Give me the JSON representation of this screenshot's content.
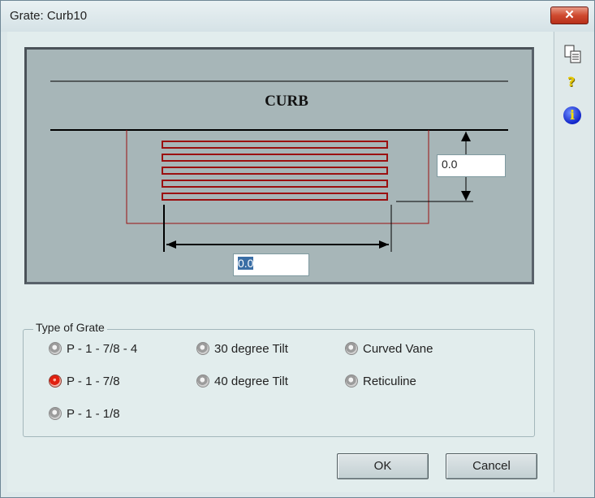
{
  "window": {
    "title": "Grate: Curb10",
    "close_label": "✕"
  },
  "sidebar": {
    "icons": [
      "copy-icon",
      "help-icon",
      "info-icon"
    ],
    "help_glyph": "?",
    "info_glyph": "i"
  },
  "diagram": {
    "curb_label": "CURB",
    "height_value": "0.0",
    "width_value": "0.0",
    "colors": {
      "grate_bars": "#9b1010",
      "inlet_outline": "#9b1010",
      "line": "#000000"
    }
  },
  "grate_type": {
    "title": "Type of Grate",
    "options": [
      {
        "label": "P - 1 - 7/8 - 4",
        "selected": false
      },
      {
        "label": "P - 1  - 7/8",
        "selected": true
      },
      {
        "label": "P - 1 - 1/8",
        "selected": false
      },
      {
        "label": "30 degree Tilt",
        "selected": false
      },
      {
        "label": "40 degree Tilt",
        "selected": false
      },
      {
        "label": "Curved Vane",
        "selected": false
      },
      {
        "label": "Reticuline",
        "selected": false
      }
    ]
  },
  "buttons": {
    "ok": "OK",
    "cancel": "Cancel"
  }
}
